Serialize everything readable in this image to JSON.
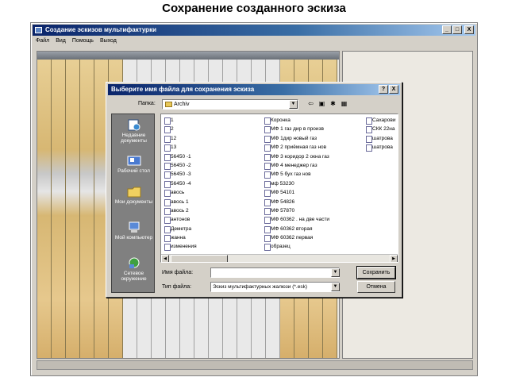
{
  "slide_title": "Сохранение созданного эскиза",
  "app": {
    "title": "Создание эскизов мультифактурки",
    "window_buttons": [
      "_",
      "□",
      "X"
    ],
    "menu": [
      "Файл",
      "Вид",
      "Помощь",
      "Выход"
    ]
  },
  "dialog": {
    "title": "Выберите имя файла для сохранения эскиза",
    "title_buttons": [
      "?",
      "X"
    ],
    "folder_label": "Папка:",
    "folder_value": "Archiv",
    "toolbar_icons": [
      "back-arrow-icon",
      "up-folder-icon",
      "new-folder-icon",
      "view-menu-icon"
    ],
    "places": [
      {
        "label": "Недавние документы",
        "icon": "recent-documents-icon"
      },
      {
        "label": "Рабочий стол",
        "icon": "desktop-icon"
      },
      {
        "label": "Мои документы",
        "icon": "my-documents-icon"
      },
      {
        "label": "Мой компьютер",
        "icon": "my-computer-icon"
      },
      {
        "label": "Сетевое окружение",
        "icon": "network-icon"
      }
    ],
    "files_col1": [
      "1",
      "2",
      "12",
      "13",
      "56450 -1",
      "56450 -2",
      "56450 -3",
      "56450 -4",
      "авось",
      "авось 1",
      "авось 2",
      "антонов",
      "Деметра",
      "жанна",
      "изменения"
    ],
    "files_col2": [
      "Коронка",
      "МФ 1 газ дир в произв",
      "МФ 1дир новый газ",
      "МФ 2 приёмная газ нов",
      "МФ 3 коридор 2 окна газ",
      "МФ 4 менеджер газ",
      "МФ 5 бух газ нов",
      "мф 53230",
      "МФ 54101",
      "МФ 54826",
      "МФ 57870",
      "МФ 60362 . на две части",
      "МФ 60362 вторая",
      "МФ 60362 первая",
      "образец"
    ],
    "files_col3": [
      "Сахарови",
      "СКК 22на",
      "шатрова",
      "шатрова"
    ],
    "filename_label": "Имя файла:",
    "filename_value": "",
    "filetype_label": "Тип файла:",
    "filetype_value": "Эскиз мультифактурных жалюзи (*.esk)",
    "save_button": "Сохранить",
    "cancel_button": "Отмена"
  },
  "colors": {
    "titlebar": "#0a246a",
    "window_face": "#d4d0c8",
    "places_bar": "#808080"
  }
}
